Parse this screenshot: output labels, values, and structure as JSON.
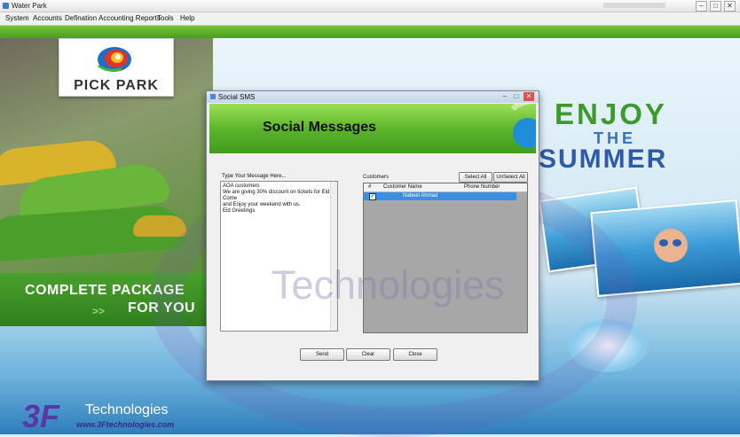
{
  "window": {
    "title": "Water Park",
    "controls": [
      "–",
      "□",
      "✕"
    ]
  },
  "menu": [
    "System",
    "Accounts",
    "Defination",
    "Accounting Reports",
    "Tools",
    "Help"
  ],
  "logo": {
    "text": "PICK PARK"
  },
  "promo": {
    "line1": "COMPLETE PACKAGE",
    "arrows": ">>",
    "line2": "FOR YOU"
  },
  "summer_banner": {
    "enjoy": "ENJOY",
    "the": "THE",
    "summer": "SUMMER"
  },
  "watermark": {
    "text": "Technologies"
  },
  "branding": {
    "mark": "3F",
    "name": "Technologies",
    "url": "www.3Ftechnologies.com"
  },
  "dialog": {
    "title": "Social SMS",
    "heading": "Social Messages",
    "message_label": "Type Your Message Here...",
    "message_lines": [
      "AOA customers",
      "We are giving 30% discount on tickets for Eid Come",
      "and Enjoy your weekend with us.",
      "Eid Greetings"
    ],
    "customers_label": "Customers",
    "select_all": "Select All",
    "unselect_all": "UnSelect All",
    "columns": [
      "#",
      "Customer Name",
      "Phone Number"
    ],
    "rows": [
      {
        "checked": true,
        "name": "Nabeel Ahmad",
        "phone": ""
      }
    ],
    "buttons": {
      "send": "Send",
      "clear": "Clear",
      "close": "Close"
    }
  }
}
